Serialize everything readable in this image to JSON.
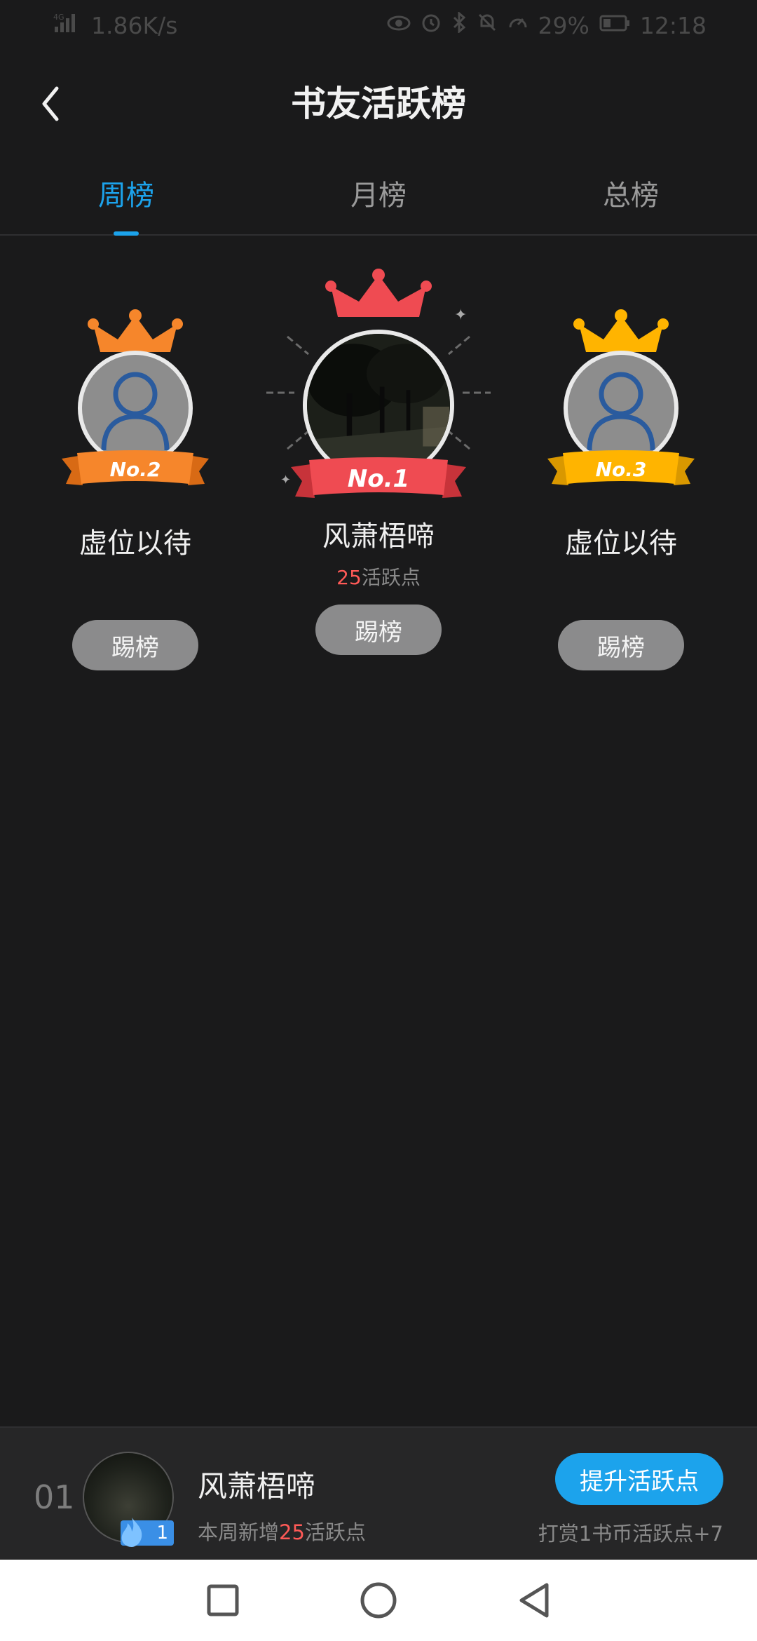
{
  "status_bar": {
    "network": "4G",
    "speed": "1.86K/s",
    "battery": "29%",
    "time": "12:18"
  },
  "header": {
    "title": "书友活跃榜",
    "back_icon": "chevron-left-icon"
  },
  "tabs": [
    {
      "label": "周榜",
      "active": true
    },
    {
      "label": "月榜",
      "active": false
    },
    {
      "label": "总榜",
      "active": false
    }
  ],
  "podium": {
    "first": {
      "badge": "No.1",
      "name": "风萧梧啼",
      "points_value": "25",
      "points_suffix": "活跃点",
      "button": "踢榜",
      "color": "#ef4b52"
    },
    "second": {
      "badge": "No.2",
      "name": "虚位以待",
      "button": "踢榜",
      "color": "#f6862b"
    },
    "third": {
      "badge": "No.3",
      "name": "虚位以待",
      "button": "踢榜",
      "color": "#ffb400"
    }
  },
  "self": {
    "rank": "01",
    "name": "风萧梧啼",
    "level": "1",
    "sub_prefix": "本周新增",
    "sub_value": "25",
    "sub_suffix": "活跃点",
    "boost_button": "提升活跃点",
    "reward_hint": "打赏1书币活跃点+7"
  },
  "colors": {
    "accent": "#1ca3ec",
    "highlight": "#ff5a57",
    "background": "#1a1a1b"
  }
}
